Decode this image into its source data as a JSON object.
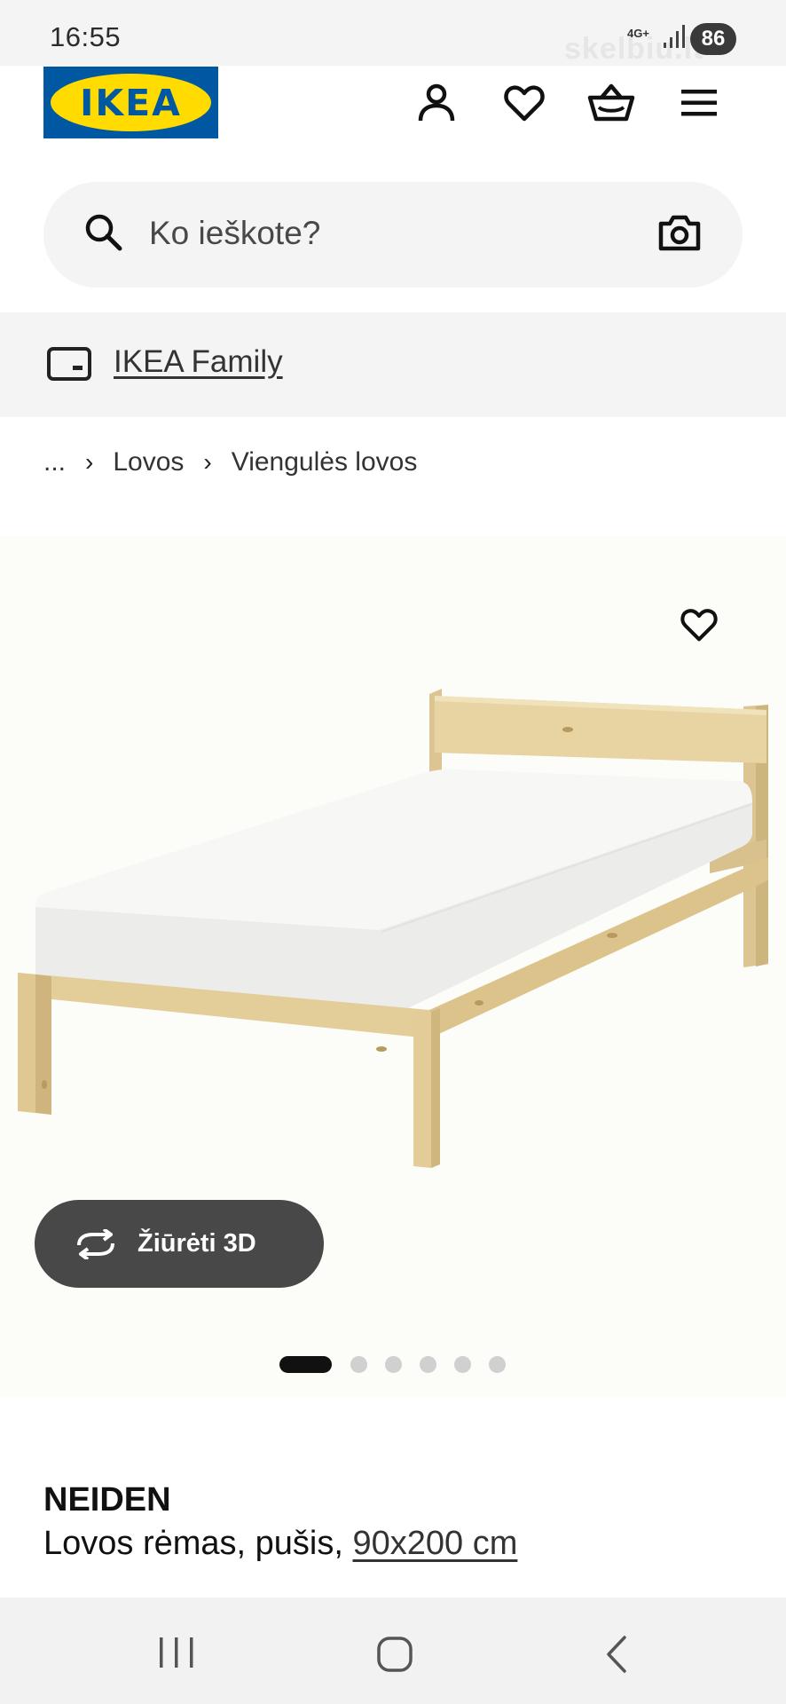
{
  "status_bar": {
    "time": "16:55",
    "network": "4G+",
    "battery": "86",
    "watermark": "skelbiu.lt"
  },
  "header": {
    "logo_text": "IKEA",
    "icons": [
      "user-icon",
      "heart-icon",
      "basket-icon",
      "menu-icon"
    ]
  },
  "search": {
    "placeholder": "Ko ieškote?"
  },
  "family": {
    "label": "IKEA Family"
  },
  "breadcrumb": {
    "ellipsis": "...",
    "items": [
      "Lovos",
      "Viengulės lovos"
    ]
  },
  "product": {
    "view3d_label": "Žiūrėti 3D",
    "image_count": 6,
    "active_image": 1,
    "name": "NEIDEN",
    "description": "Lovos rėmas, pušis,",
    "size": "90x200 cm"
  },
  "colors": {
    "ikea_blue": "#0058a3",
    "ikea_yellow": "#ffdb00"
  }
}
